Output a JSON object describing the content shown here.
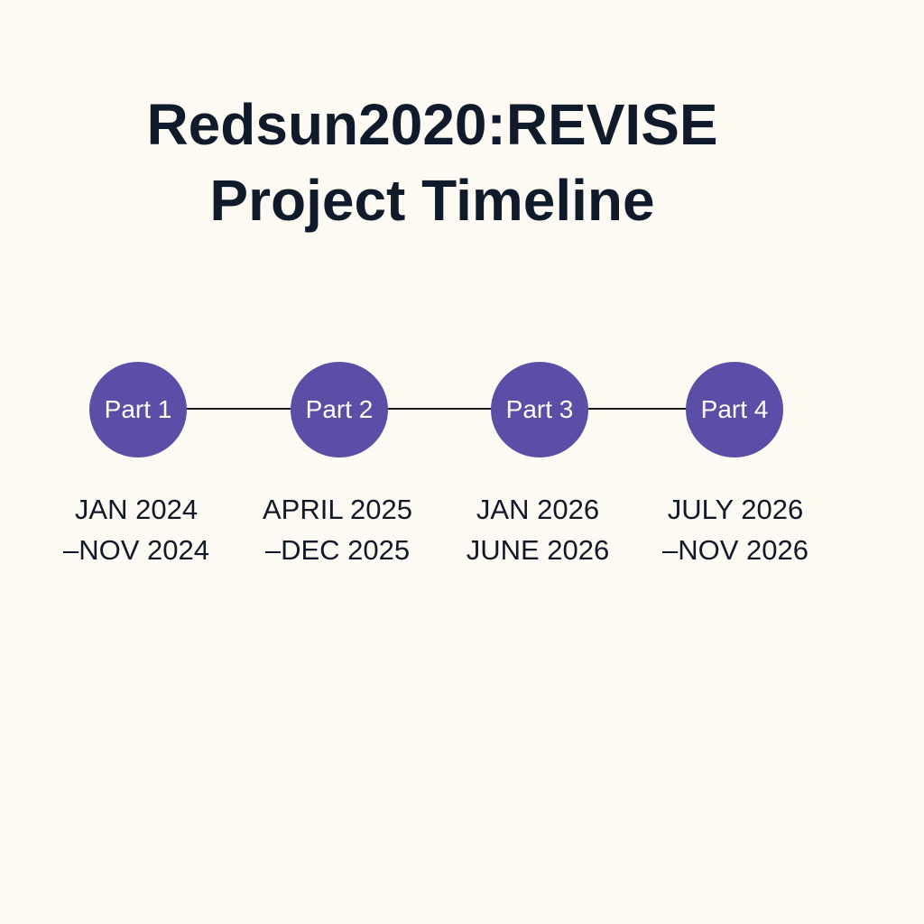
{
  "title": {
    "line1": "Redsun2020:REVISE",
    "line2": "Project Timeline"
  },
  "accent_color": "#5a4ea6",
  "phases": [
    {
      "label": "Part 1",
      "line1": "JAN 2024",
      "line2": "–NOV 2024"
    },
    {
      "label": "Part 2",
      "line1": "APRIL 2025",
      "line2": "–DEC 2025"
    },
    {
      "label": "Part 3",
      "line1": "JAN 2026",
      "line2": "JUNE 2026"
    },
    {
      "label": "Part 4",
      "line1": "JULY 2026",
      "line2": "–NOV 2026"
    }
  ]
}
